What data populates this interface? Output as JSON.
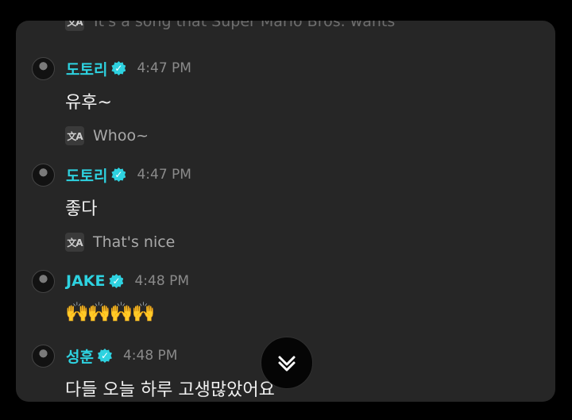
{
  "cut_message": {
    "translation": "It's a song that Super Mario Bros. wants"
  },
  "messages": [
    {
      "author": "도토리",
      "time": "4:47 PM",
      "text": "유후~",
      "translation": "Whoo~"
    },
    {
      "author": "도토리",
      "time": "4:47 PM",
      "text": "좋다",
      "translation": "That's nice"
    },
    {
      "author": "JAKE",
      "time": "4:48 PM",
      "text": "🙌🙌🙌🙌"
    },
    {
      "author": "성훈",
      "time": "4:48 PM",
      "text": "다들 오늘 하루 고생많았어요"
    }
  ],
  "icons": {
    "translate": "translate-icon",
    "verified": "verified-badge-icon",
    "scroll": "double-chevron-down-icon"
  },
  "colors": {
    "background": "#000000",
    "panel": "#262626",
    "accent": "#2ed2e0",
    "time": "#8a8a8a",
    "text": "#f1f1f1"
  }
}
